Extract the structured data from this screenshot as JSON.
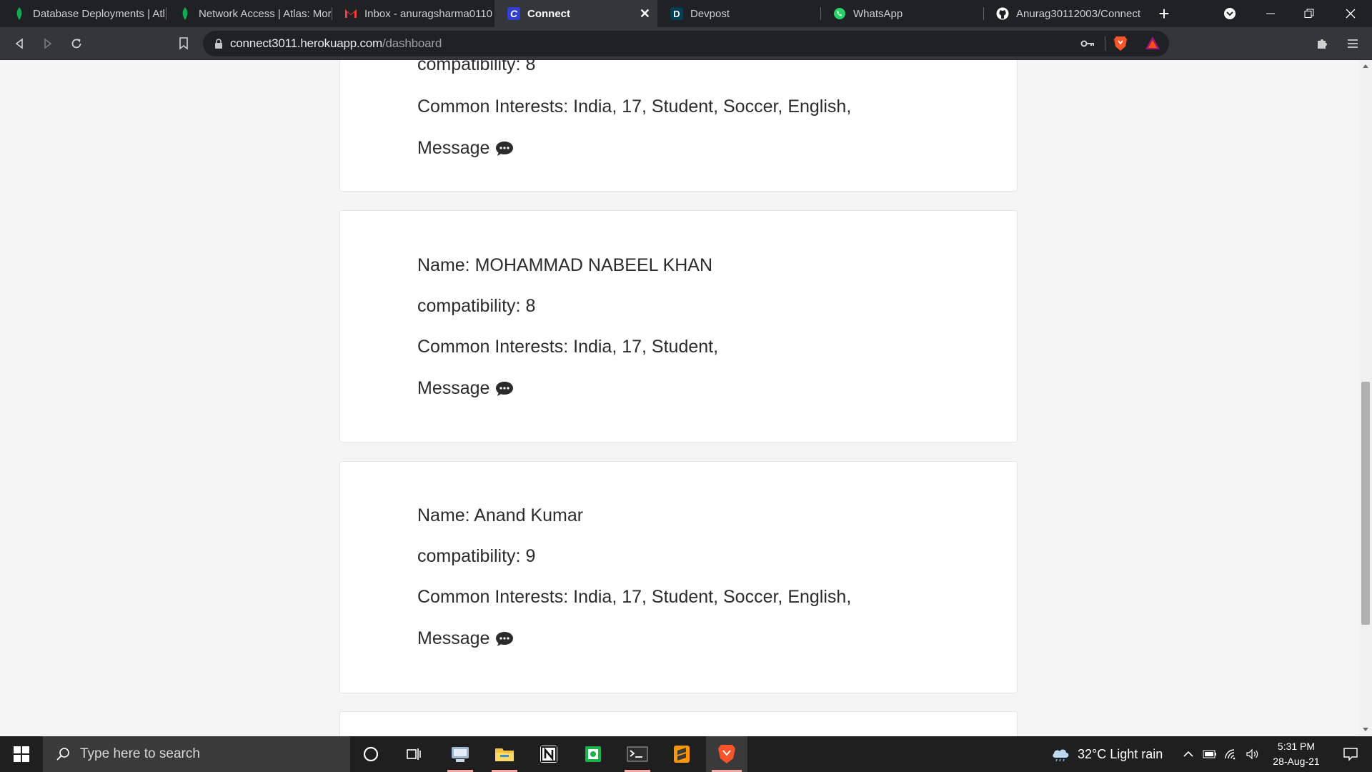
{
  "browser": {
    "tabs": [
      {
        "label": "Database Deployments | Atl",
        "icon": "mongodb-leaf-icon"
      },
      {
        "label": "Network Access | Atlas: Mor",
        "icon": "mongodb-leaf-icon"
      },
      {
        "label": "Inbox - anuragsharma0110",
        "icon": "gmail-icon"
      },
      {
        "label": "Connect",
        "icon": "connect-c-icon",
        "active": true
      },
      {
        "label": "Devpost",
        "icon": "devpost-d-icon"
      },
      {
        "label": "WhatsApp",
        "icon": "whatsapp-icon"
      },
      {
        "label": "Anurag30112003/Connect",
        "icon": "github-icon"
      }
    ],
    "url_host": "connect3011.herokuapp.com",
    "url_path": "/dashboard"
  },
  "cards": [
    {
      "name_line": "compatibility: 8",
      "compat_line": "",
      "interests_line": "Common Interests: India, 17, Student, Soccer, English,",
      "message_label": "Message"
    },
    {
      "name_line": "Name: MOHAMMAD NABEEL KHAN",
      "compat_line": "compatibility: 8",
      "interests_line": "Common Interests: India, 17, Student,",
      "message_label": "Message"
    },
    {
      "name_line": "Name: Anand Kumar",
      "compat_line": "compatibility: 9",
      "interests_line": "Common Interests: India, 17, Student, Soccer, English,",
      "message_label": "Message"
    }
  ],
  "taskbar": {
    "search_placeholder": "Type here to search",
    "weather": "32°C  Light rain",
    "time": "5:31 PM",
    "date": "28-Aug-21"
  },
  "colors": {
    "tab_bg": "#202124",
    "toolbar_bg": "#35363a",
    "page_bg": "#f5f5f5",
    "card_bg": "#ffffff",
    "text": "#2b2b2b"
  }
}
